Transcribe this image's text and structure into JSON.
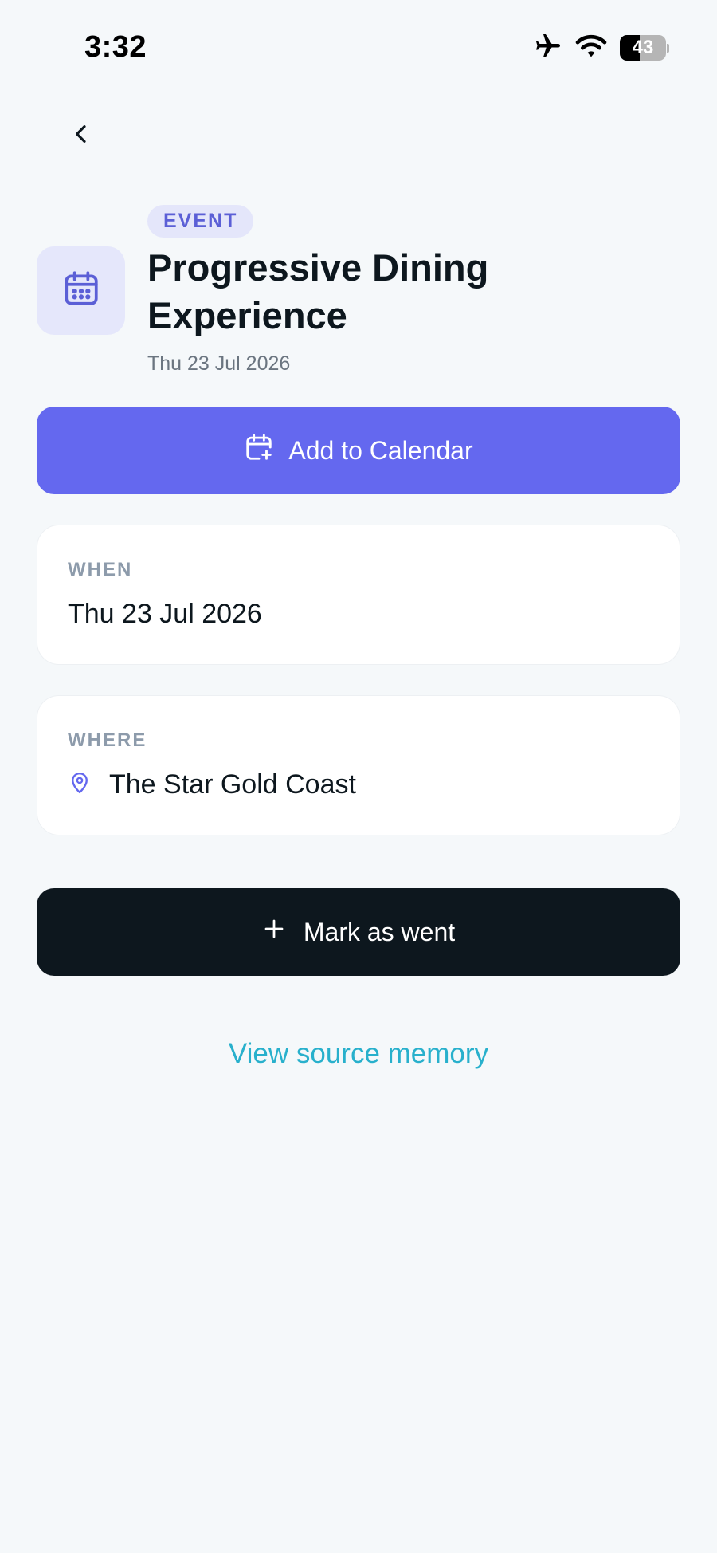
{
  "status_bar": {
    "time": "3:32",
    "battery_level": "43",
    "battery_fraction": 0.43
  },
  "icons": {
    "back": "chevron-left-icon",
    "event": "calendar-icon",
    "add_calendar": "calendar-plus-icon",
    "location": "map-pin-icon",
    "mark": "plus-icon",
    "airplane": "airplane-icon",
    "wifi": "wifi-icon",
    "battery": "battery-icon"
  },
  "header": {
    "badge": "EVENT",
    "title": "Progressive Dining Experience",
    "subtitle": "Thu 23 Jul 2026"
  },
  "actions": {
    "add_calendar_label": "Add to Calendar",
    "mark_went_label": "Mark as went",
    "view_source_label": "View source memory"
  },
  "details": {
    "when": {
      "label": "WHEN",
      "value": "Thu 23 Jul 2026"
    },
    "where": {
      "label": "WHERE",
      "value": "The Star Gold Coast"
    }
  },
  "colors": {
    "background": "#f5f8fa",
    "accent": "#6468ef",
    "badge_bg": "#e4e6fa",
    "dark_button": "#0d171e",
    "link": "#28b0cc",
    "muted_label": "#8d9bab"
  }
}
